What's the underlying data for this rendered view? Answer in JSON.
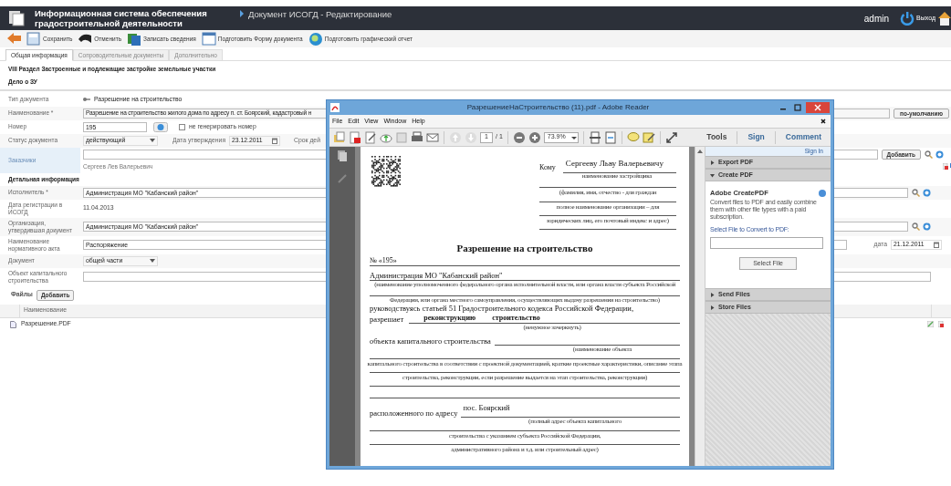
{
  "app_header": {
    "title": "Информационная система обеспечения градостроительной деятельности",
    "breadcrumb": "Документ ИСОГД - Редактирование",
    "user": "admin",
    "logout": "Выход"
  },
  "toolbar": [
    {
      "kind": "back"
    },
    {
      "kind": "save",
      "label": "Сохранить"
    },
    {
      "kind": "undo",
      "label": "Отменить"
    },
    {
      "kind": "record",
      "label": "Записать сведения"
    },
    {
      "kind": "form",
      "label": "Подготовить Форму документа"
    },
    {
      "kind": "report",
      "label": "Подготовить графический отчет"
    }
  ],
  "tabs": [
    {
      "label": "Общая информация",
      "selected": true
    },
    {
      "label": "Сопроводительные документы",
      "selected": false
    },
    {
      "label": "Дополнительно",
      "selected": false
    }
  ],
  "section_title": "VIII Раздел Застроенные и подлежащие застройке земельные участки",
  "case_title": "Дело о ЗУ",
  "form": {
    "doc_type": {
      "label": "Тип документа",
      "value": "Разрешение на строительство"
    },
    "name": {
      "label": "Наименование *",
      "value": "Разрешение на строительство жилого дома по адресу п. ст. Боярский, кадастровый н",
      "button": "по-умолчанию"
    },
    "number": {
      "label": "Номер",
      "value": "195",
      "no_generate": {
        "label": "не генерировать номер",
        "checked": false
      }
    },
    "status": {
      "label": "Статус документа",
      "value": "действующий",
      "approval_date_label": "Дата утверждения",
      "approval_date": "23.12.2011",
      "validity_label": "Срок дей"
    },
    "customers": {
      "label": "Заказчики",
      "button": "Добавить",
      "items": [
        "Сергеев Лев Валерьевич"
      ]
    },
    "detail_heading": "Детальная информация",
    "executor": {
      "label": "Исполнитель *",
      "value": "Администрация МО \"Кабанский район\""
    },
    "registration_date": {
      "label": "Дата регистрации в ИСОГД",
      "value": "11.04.2013"
    },
    "organization": {
      "label": "Организация, утвердившая документ",
      "value": "Администрация МО \"Кабанский район\""
    },
    "act_name": {
      "label": "Наименование нормативного акта",
      "value": "Распоряжение",
      "date_label": "дата",
      "date": "21.12.2011"
    },
    "document": {
      "label": "Документ",
      "value": "общей части"
    },
    "object": {
      "label": "Объект капитального строительства"
    }
  },
  "files": {
    "label": "Файлы",
    "button": "Добавить",
    "column": "Наименование",
    "rows": [
      {
        "name": "Разрешение.PDF"
      }
    ]
  },
  "reader": {
    "title": "РазрешениеНаСтроительство (11).pdf - Adobe Reader",
    "menu": [
      "File",
      "Edit",
      "View",
      "Window",
      "Help"
    ],
    "page": "1",
    "page_total": "/ 1",
    "zoom": "73.9%",
    "panel_tabs": [
      "Tools",
      "Sign",
      "Comment"
    ],
    "sign_in": "Sign In",
    "sections": [
      {
        "title": "Export PDF",
        "expanded": false
      },
      {
        "title": "Create PDF",
        "expanded": true
      },
      {
        "title": "Send Files",
        "expanded": false
      },
      {
        "title": "Store Files",
        "expanded": false
      }
    ],
    "create_pdf": {
      "heading": "Adobe CreatePDF",
      "text": "Convert files to PDF and easily combine them with other file types with a paid subscription.",
      "select_label": "Select File to Convert to PDF:",
      "button": "Select File"
    },
    "document": {
      "to_label": "Кому",
      "recipient": "Сергееву Льву Валерьевичу",
      "recipient_notes": [
        "наименование застройщика",
        "(фамилия, имя, отчество - для граждан",
        "полное наименование организации – для",
        "юридических лиц, его почтовый индекс и адрес)"
      ],
      "heading": "Разрешение на строительство",
      "number": "№ «195»",
      "issuer": "Администрация МО \"Кабанский район\"",
      "issuer_notes": [
        "(наименование уполномоченного федерального органа исполнительной власти, или органа власти субъекта Российской",
        "Федерации, или органа местного самоуправления, осуществляющих выдачу разрешения на строительство)"
      ],
      "basis": "руководствуясь статьей 51 Градостроительного кодекса Российской Федерации,",
      "permits_label": "разрешает",
      "permits": [
        "реконструкцию",
        "строительство"
      ],
      "permits_note": "(ненужное зачеркнуть)",
      "object_label": "объекта капитального строительства",
      "object_notes": [
        "(наименование объекта",
        "капитального строительства в соответствии с проектной документацией, краткие проектные характеристики, описание этапа",
        "строительства, реконструкции, если разрешение выдается на этап строительства, реконструкции)"
      ],
      "address_label": "расположенного по адресу",
      "address": "пос. Боярский",
      "address_notes": [
        "(полный адрес объекта капитального",
        "строительства с указанием субъекта Российской Федерации,",
        "административного района и т.д. или строительный адрес)"
      ]
    }
  }
}
